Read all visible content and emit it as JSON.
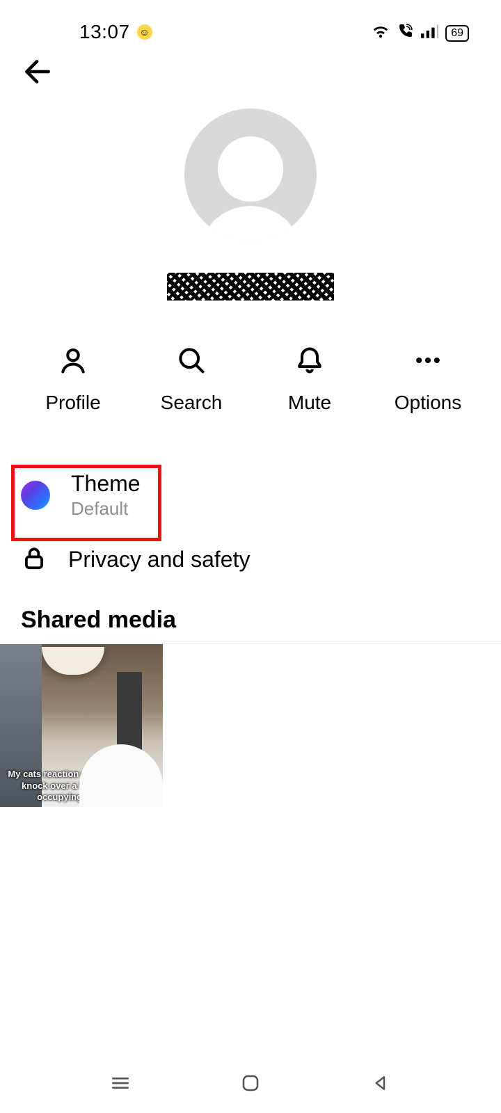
{
  "status": {
    "time": "13:07",
    "battery": "69"
  },
  "username_redacted": true,
  "actions": {
    "profile": "Profile",
    "search": "Search",
    "mute": "Mute",
    "options": "Options"
  },
  "settings": {
    "theme": {
      "title": "Theme",
      "subtitle": "Default"
    },
    "privacy": {
      "title": "Privacy and safety"
    }
  },
  "shared_media": {
    "title": "Shared media",
    "items": [
      {
        "caption": "My cats reaction when he couldn't knock over a bottle of water occupying his space"
      }
    ]
  }
}
